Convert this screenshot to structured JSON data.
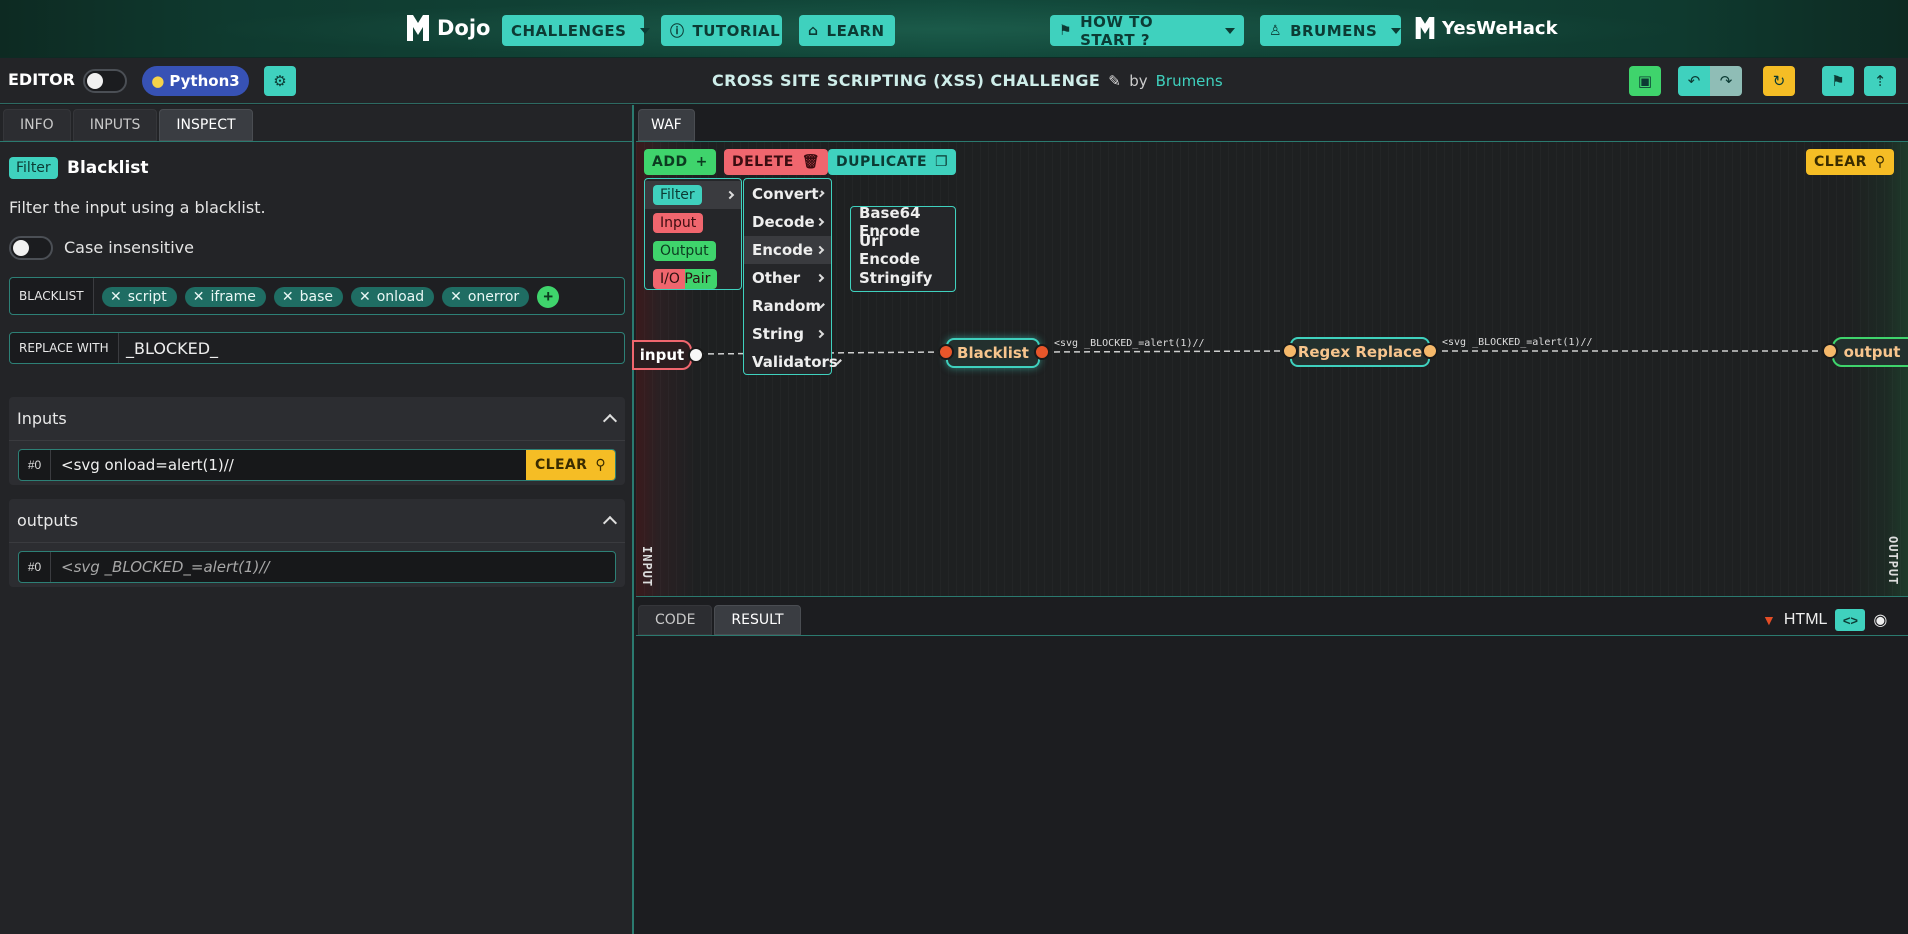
{
  "topnav": {
    "brand": "Dojo",
    "challenges": "CHALLENGES",
    "tutorial": "TUTORIAL",
    "learn": "LEARN",
    "how_to_start": "HOW TO START ?",
    "user": "BRUMENS",
    "partner": "YesWeHack"
  },
  "editorbar": {
    "title": "EDITOR",
    "language": "Python3",
    "challenge_title": "CROSS SITE SCRIPTING (XSS) CHALLENGE",
    "by": "by",
    "author": "Brumens"
  },
  "left": {
    "tabs": [
      "INFO",
      "INPUTS",
      "INSPECT"
    ],
    "node_category": "Filter",
    "node_name": "Blacklist",
    "description": "Filter the input using a blacklist.",
    "case_insensitive_label": "Case insensitive",
    "blacklist_label": "BLACKLIST",
    "blacklist": [
      "script",
      "iframe",
      "base",
      "onload",
      "onerror"
    ],
    "replace_label": "REPLACE WITH",
    "replace_value": "_BLOCKED_",
    "inputs_title": "Inputs",
    "input_index": "#0",
    "input_value": "<svg onload=alert(1)//",
    "clear_label": "CLEAR",
    "outputs_title": "outputs",
    "output_index": "#0",
    "output_value": "<svg _BLOCKED_=alert(1)//"
  },
  "canvas": {
    "tab": "WAF",
    "add": "ADD",
    "delete": "DELETE",
    "duplicate": "DUPLICATE",
    "clear": "CLEAR",
    "categories": [
      {
        "label": "Filter",
        "color": "#3fd1be"
      },
      {
        "label": "Input",
        "color": "#f0666e"
      },
      {
        "label": "Output",
        "color": "#3fd46c"
      },
      {
        "label": "I/O Pair",
        "color": "#f0666e"
      }
    ],
    "submenu": [
      "Convert",
      "Decode",
      "Encode",
      "Other",
      "Random",
      "String",
      "Validators"
    ],
    "encode_menu": [
      "Base64 Encode",
      "Url Encode",
      "Stringify"
    ],
    "nodes": {
      "input": "input",
      "blacklist": "Blacklist",
      "regex": "Regex Replace",
      "output": "output"
    },
    "edge1": "<svg _BLOCKED_=alert(1)//",
    "edge2": "<svg _BLOCKED_=alert(1)//",
    "input_side": "INPUT",
    "output_side": "OUTPUT"
  },
  "bottom": {
    "tabs": [
      "CODE",
      "RESULT"
    ],
    "format": "HTML"
  },
  "colors": {
    "accent": "#3fd1be",
    "danger": "#f0666e",
    "warning": "#f5bd25",
    "success": "#3fd46c"
  }
}
